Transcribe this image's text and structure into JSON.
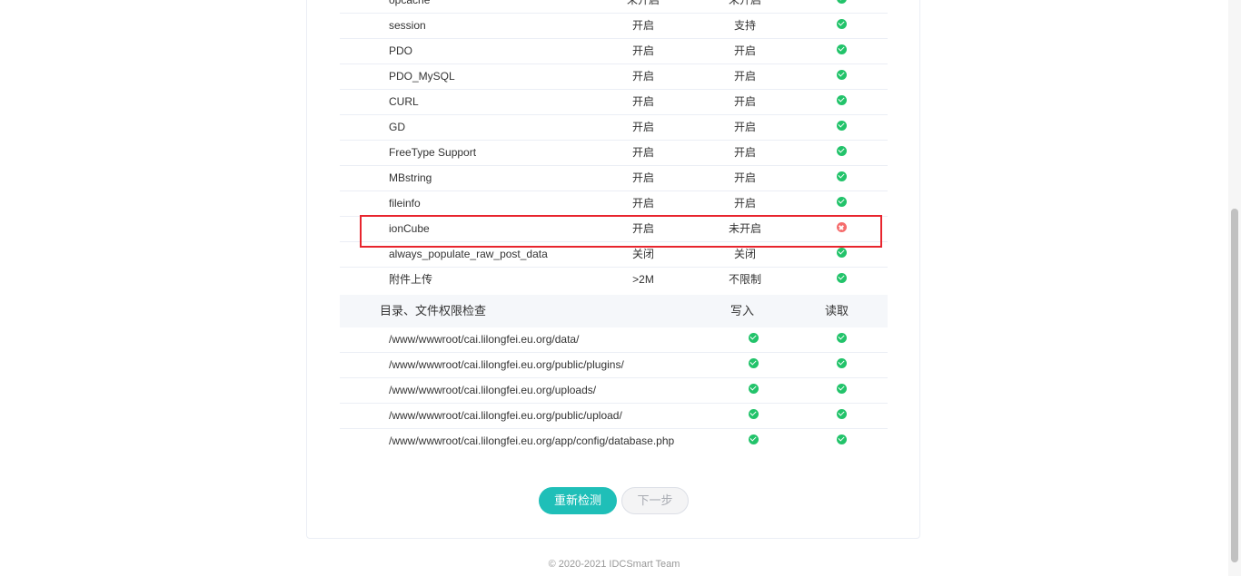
{
  "env_checks": [
    {
      "name": "opcache",
      "required": "未开启",
      "current": "未开启",
      "ok": true
    },
    {
      "name": "session",
      "required": "开启",
      "current": "支持",
      "ok": true
    },
    {
      "name": "PDO",
      "required": "开启",
      "current": "开启",
      "ok": true
    },
    {
      "name": "PDO_MySQL",
      "required": "开启",
      "current": "开启",
      "ok": true
    },
    {
      "name": "CURL",
      "required": "开启",
      "current": "开启",
      "ok": true
    },
    {
      "name": "GD",
      "required": "开启",
      "current": "开启",
      "ok": true
    },
    {
      "name": "FreeType Support",
      "required": "开启",
      "current": "开启",
      "ok": true
    },
    {
      "name": "MBstring",
      "required": "开启",
      "current": "开启",
      "ok": true
    },
    {
      "name": "fileinfo",
      "required": "开启",
      "current": "开启",
      "ok": true
    },
    {
      "name": "ionCube",
      "required": "开启",
      "current": "未开启",
      "ok": false
    },
    {
      "name": "always_populate_raw_post_data",
      "required": "关闭",
      "current": "关闭",
      "ok": true
    },
    {
      "name": "附件上传",
      "required": ">2M",
      "current": "不限制",
      "ok": true
    }
  ],
  "dir_section": {
    "title": "目录、文件权限检查",
    "write_label": "写入",
    "read_label": "读取"
  },
  "dir_checks": [
    {
      "path": "/www/wwwroot/cai.lilongfei.eu.org/data/",
      "write": true,
      "read": true
    },
    {
      "path": "/www/wwwroot/cai.lilongfei.eu.org/public/plugins/",
      "write": true,
      "read": true
    },
    {
      "path": "/www/wwwroot/cai.lilongfei.eu.org/uploads/",
      "write": true,
      "read": true
    },
    {
      "path": "/www/wwwroot/cai.lilongfei.eu.org/public/upload/",
      "write": true,
      "read": true
    },
    {
      "path": "/www/wwwroot/cai.lilongfei.eu.org/app/config/database.php",
      "write": true,
      "read": true
    }
  ],
  "buttons": {
    "recheck": "重新检测",
    "next": "下一步"
  },
  "footer": {
    "copyright": "© 2020-2021 IDCSmart Team"
  },
  "colors": {
    "accent": "#1fbfb8",
    "success": "#22c36a",
    "error": "#f56c6c",
    "highlight": "#e8252e"
  }
}
